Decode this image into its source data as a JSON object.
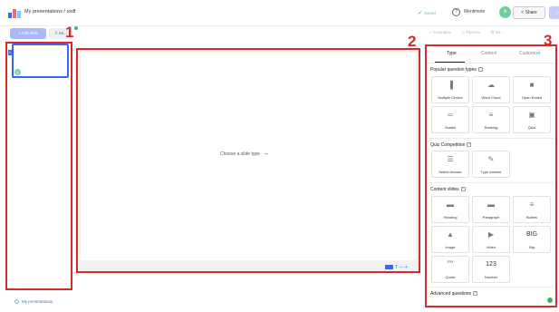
{
  "header": {
    "breadcrumb": "My presentations / sxdf",
    "saved_label": "Saved",
    "help_icon": "question-circle-icon",
    "mentimote_label": "Mentimote",
    "avatar_initial": "A",
    "share_label": "< Share",
    "present_label": "▷ Present"
  },
  "toolbar": {
    "add_slide_label": "+ Add slide",
    "import_label": "⇧ Im...",
    "examples_label": "☆ Examples",
    "themes_label": "◇ Themes",
    "settings_label": "⚙ Se..."
  },
  "slides": [
    {
      "number": "1",
      "badge": "A"
    }
  ],
  "canvas": {
    "prompt": "Choose a slide type",
    "arrow": "→",
    "footer_text": "T — +"
  },
  "annotations": [
    "1",
    "2",
    "3"
  ],
  "panel": {
    "tabs": [
      {
        "label": "Type",
        "active": true
      },
      {
        "label": "Content",
        "active": false
      },
      {
        "label": "Customize",
        "active": false
      }
    ],
    "sections": [
      {
        "title": "Popular question types",
        "tiles": [
          {
            "label": "Multiple Choice",
            "icon": "bar-chart-icon",
            "glyph": "▐"
          },
          {
            "label": "Word Cloud",
            "icon": "cloud-icon",
            "glyph": "☁"
          },
          {
            "label": "Open Ended",
            "icon": "speech-bubbles-icon",
            "glyph": "■"
          },
          {
            "label": "Scales",
            "icon": "scales-icon",
            "glyph": "═"
          },
          {
            "label": "Ranking",
            "icon": "ranking-icon",
            "glyph": "≡"
          },
          {
            "label": "Q&A",
            "icon": "qa-icon",
            "glyph": "▣"
          }
        ]
      },
      {
        "title": "Quiz Competition",
        "tiles": [
          {
            "label": "Select Answer",
            "icon": "list-icon",
            "glyph": "☰"
          },
          {
            "label": "Type Answer",
            "icon": "pencil-icon",
            "glyph": "✎"
          }
        ]
      },
      {
        "title": "Content slides",
        "tiles": [
          {
            "label": "Heading",
            "icon": "heading-icon",
            "glyph": "▬"
          },
          {
            "label": "Paragraph",
            "icon": "paragraph-icon",
            "glyph": "▬"
          },
          {
            "label": "Bullets",
            "icon": "bullets-icon",
            "glyph": "≡"
          },
          {
            "label": "Image",
            "icon": "image-icon",
            "glyph": "▲"
          },
          {
            "label": "Video",
            "icon": "video-play-icon",
            "glyph": "▶"
          },
          {
            "label": "Big",
            "icon": "big-text-icon",
            "glyph": "BIG"
          },
          {
            "label": "Quote",
            "icon": "quote-icon",
            "glyph": "““"
          },
          {
            "label": "Number",
            "icon": "number-icon",
            "glyph": "123"
          }
        ]
      },
      {
        "title": "Advanced questions",
        "tiles": []
      }
    ]
  },
  "sidebar_footer": {
    "my_presentations_label": "My presentations"
  },
  "colors": {
    "annotation_red": "#d42a2a",
    "accent_blue": "#3b66f5",
    "saved_green": "#3aa875"
  }
}
